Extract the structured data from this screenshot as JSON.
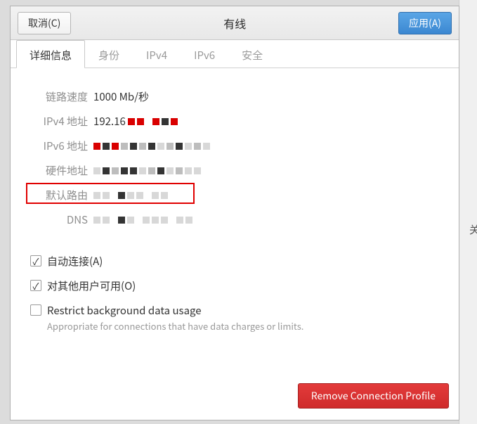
{
  "titlebar": {
    "cancel": "取消(C)",
    "title": "有线",
    "apply": "应用(A)"
  },
  "tabs": [
    {
      "id": "details",
      "label": "详细信息",
      "active": true
    },
    {
      "id": "identity",
      "label": "身份",
      "active": false
    },
    {
      "id": "ipv4",
      "label": "IPv4",
      "active": false
    },
    {
      "id": "ipv6",
      "label": "IPv6",
      "active": false
    },
    {
      "id": "security",
      "label": "安全",
      "active": false
    }
  ],
  "details": {
    "link_speed": {
      "label": "链路速度",
      "value": "1000 Mb/秒"
    },
    "ipv4_address": {
      "label": "IPv4 地址",
      "value_visible_prefix": "192.16",
      "redacted": true
    },
    "ipv6_address": {
      "label": "IPv6 地址",
      "redacted": true
    },
    "hw_address": {
      "label": "硬件地址",
      "redacted": true
    },
    "default_route": {
      "label": "默认路由",
      "redacted": true
    },
    "dns": {
      "label": "DNS",
      "redacted": true
    }
  },
  "options": {
    "auto_connect": {
      "label": "自动连接(A)",
      "checked": true
    },
    "available_all": {
      "label": "对其他用户可用(O)",
      "checked": true
    },
    "restrict_bg": {
      "label": "Restrict background data usage",
      "sub": "Appropriate for connections that have data charges or limits.",
      "checked": false
    }
  },
  "footer": {
    "remove": "Remove Connection Profile"
  },
  "right_sliver_text": "关"
}
